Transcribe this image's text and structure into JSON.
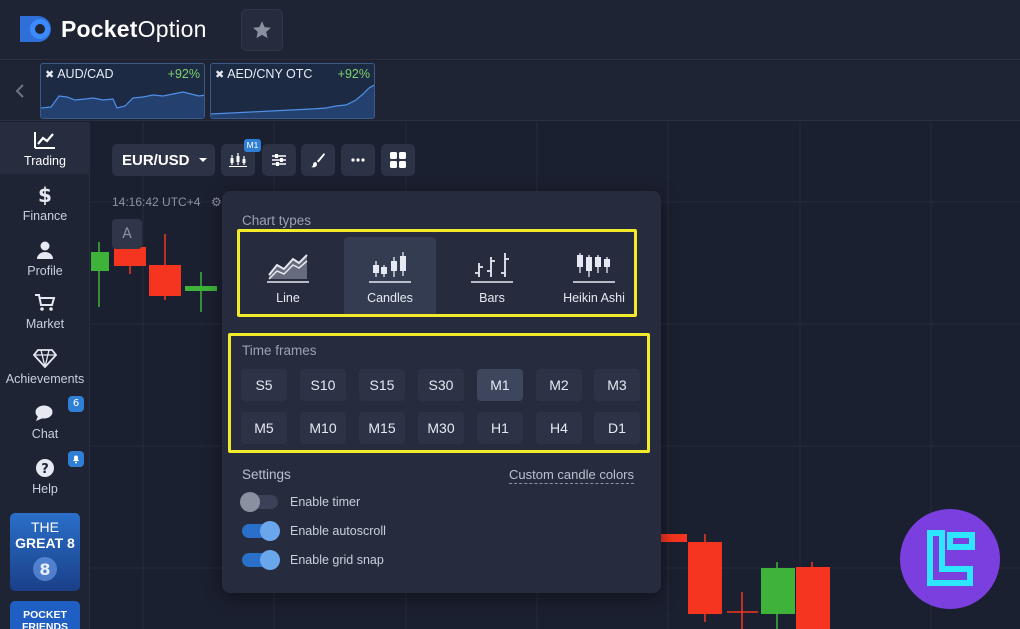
{
  "brand": {
    "name_bold": "Pocket",
    "name_light": "Option"
  },
  "assets": [
    {
      "name": "AUD/CAD",
      "payout": "+92%"
    },
    {
      "name": "AED/CNY OTC",
      "payout": "+92%"
    }
  ],
  "sidebar": {
    "items": [
      {
        "label": "Trading",
        "icon": "trading-chart-icon"
      },
      {
        "label": "Finance",
        "icon": "dollar-icon"
      },
      {
        "label": "Profile",
        "icon": "user-icon"
      },
      {
        "label": "Market",
        "icon": "cart-icon"
      },
      {
        "label": "Achievements",
        "icon": "diamond-icon"
      },
      {
        "label": "Chat",
        "icon": "chat-icon",
        "badge": "6"
      },
      {
        "label": "Help",
        "icon": "help-icon"
      }
    ],
    "promo": {
      "line1": "THE",
      "line2": "GREAT 8"
    },
    "promo2": {
      "line1": "POCKET",
      "line2": "FRIENDS"
    }
  },
  "toolbar": {
    "pair": "EUR/USD",
    "timeframe_badge": "M1",
    "time": "14:16:42 UTC+4",
    "drawing_label": "A"
  },
  "panel": {
    "chart_types_title": "Chart types",
    "chart_types": [
      {
        "label": "Line",
        "icon": "line-chart-icon"
      },
      {
        "label": "Candles",
        "icon": "candles-icon",
        "active": true
      },
      {
        "label": "Bars",
        "icon": "bars-icon"
      },
      {
        "label": "Heikin Ashi",
        "icon": "heikin-ashi-icon"
      }
    ],
    "time_frames_title": "Time frames",
    "time_frames_row1": [
      "S5",
      "S10",
      "S15",
      "S30",
      "M1",
      "M2",
      "M3"
    ],
    "time_frames_row2": [
      "M5",
      "M10",
      "M15",
      "M30",
      "H1",
      "H4",
      "D1"
    ],
    "active_time_frame": "M1",
    "settings_title": "Settings",
    "custom_colors_link": "Custom candle colors",
    "toggles": [
      {
        "label": "Enable timer",
        "on": false
      },
      {
        "label": "Enable autoscroll",
        "on": true
      },
      {
        "label": "Enable grid snap",
        "on": true
      }
    ]
  },
  "colors": {
    "accent": "#2f7fd6",
    "highlight": "#f2ea2a",
    "bull": "#3fb23a",
    "bear": "#f5351f"
  }
}
